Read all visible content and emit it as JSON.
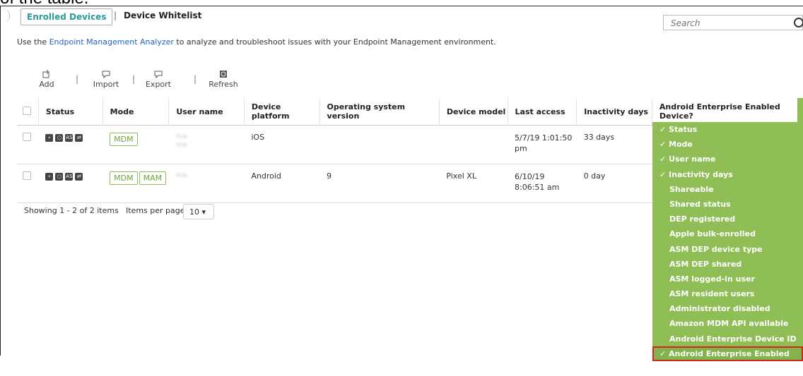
{
  "top_fragment": "of the table.",
  "header": {
    "tab_enrolled": "Enrolled Devices",
    "separator": "|",
    "tab_whitelist": "Device Whitelist"
  },
  "search": {
    "placeholder": "Search"
  },
  "info": {
    "prefix": "Use the ",
    "link": "Endpoint Management Analyzer",
    "suffix": " to analyze and troubleshoot issues with your Endpoint Management environment."
  },
  "toolbar": {
    "add": "Add",
    "import": "Import",
    "export": "Export",
    "refresh": "Refresh",
    "sep": "|"
  },
  "table": {
    "headers": [
      "Status",
      "Mode",
      "User name",
      "Device platform",
      "Operating system version",
      "Device model",
      "Last access",
      "Inactivity days",
      "Android Enterprise Enabled Device?"
    ],
    "rows": [
      {
        "modes": [
          "MDM"
        ],
        "user_line1": "n/a",
        "user_line2": "n/a",
        "platform": "iOS",
        "os_version": "",
        "model": "",
        "last_access": "5/7/19 1:01:50 pm",
        "inactivity": "33 days"
      },
      {
        "modes": [
          "MDM",
          "MAM"
        ],
        "user_line1": "n/a",
        "user_line2": "",
        "platform": "Android",
        "os_version": "9",
        "model": "Pixel XL",
        "last_access": "6/10/19 8:06:51 am",
        "inactivity": "0 day"
      }
    ]
  },
  "pager": {
    "showing": "Showing 1 - 2 of 2 items",
    "per_page_label": "Items per page:",
    "per_page_value": "10 ▾"
  },
  "columns_menu": {
    "items": [
      {
        "label": "Status",
        "checked": true
      },
      {
        "label": "Mode",
        "checked": true
      },
      {
        "label": "User name",
        "checked": true
      },
      {
        "label": "Inactivity days",
        "checked": true
      },
      {
        "label": "Shareable",
        "checked": false
      },
      {
        "label": "Shared status",
        "checked": false
      },
      {
        "label": "DEP registered",
        "checked": false
      },
      {
        "label": "Apple bulk-enrolled",
        "checked": false
      },
      {
        "label": "ASM DEP device type",
        "checked": false
      },
      {
        "label": "ASM DEP shared",
        "checked": false
      },
      {
        "label": "ASM logged-in user",
        "checked": false
      },
      {
        "label": "ASM resident users",
        "checked": false
      },
      {
        "label": "Administrator disabled",
        "checked": false
      },
      {
        "label": "Amazon MDM API available",
        "checked": false
      },
      {
        "label": "Android Enterprise Device ID",
        "checked": false
      },
      {
        "label": "Android Enterprise Enabled Device?",
        "checked": true,
        "highlighted": true
      }
    ]
  },
  "colors": {
    "accent_teal": "#2b9a9a",
    "link_blue": "#1e63c7",
    "menu_green": "#8fbd56",
    "highlight_red": "#d0271d"
  }
}
